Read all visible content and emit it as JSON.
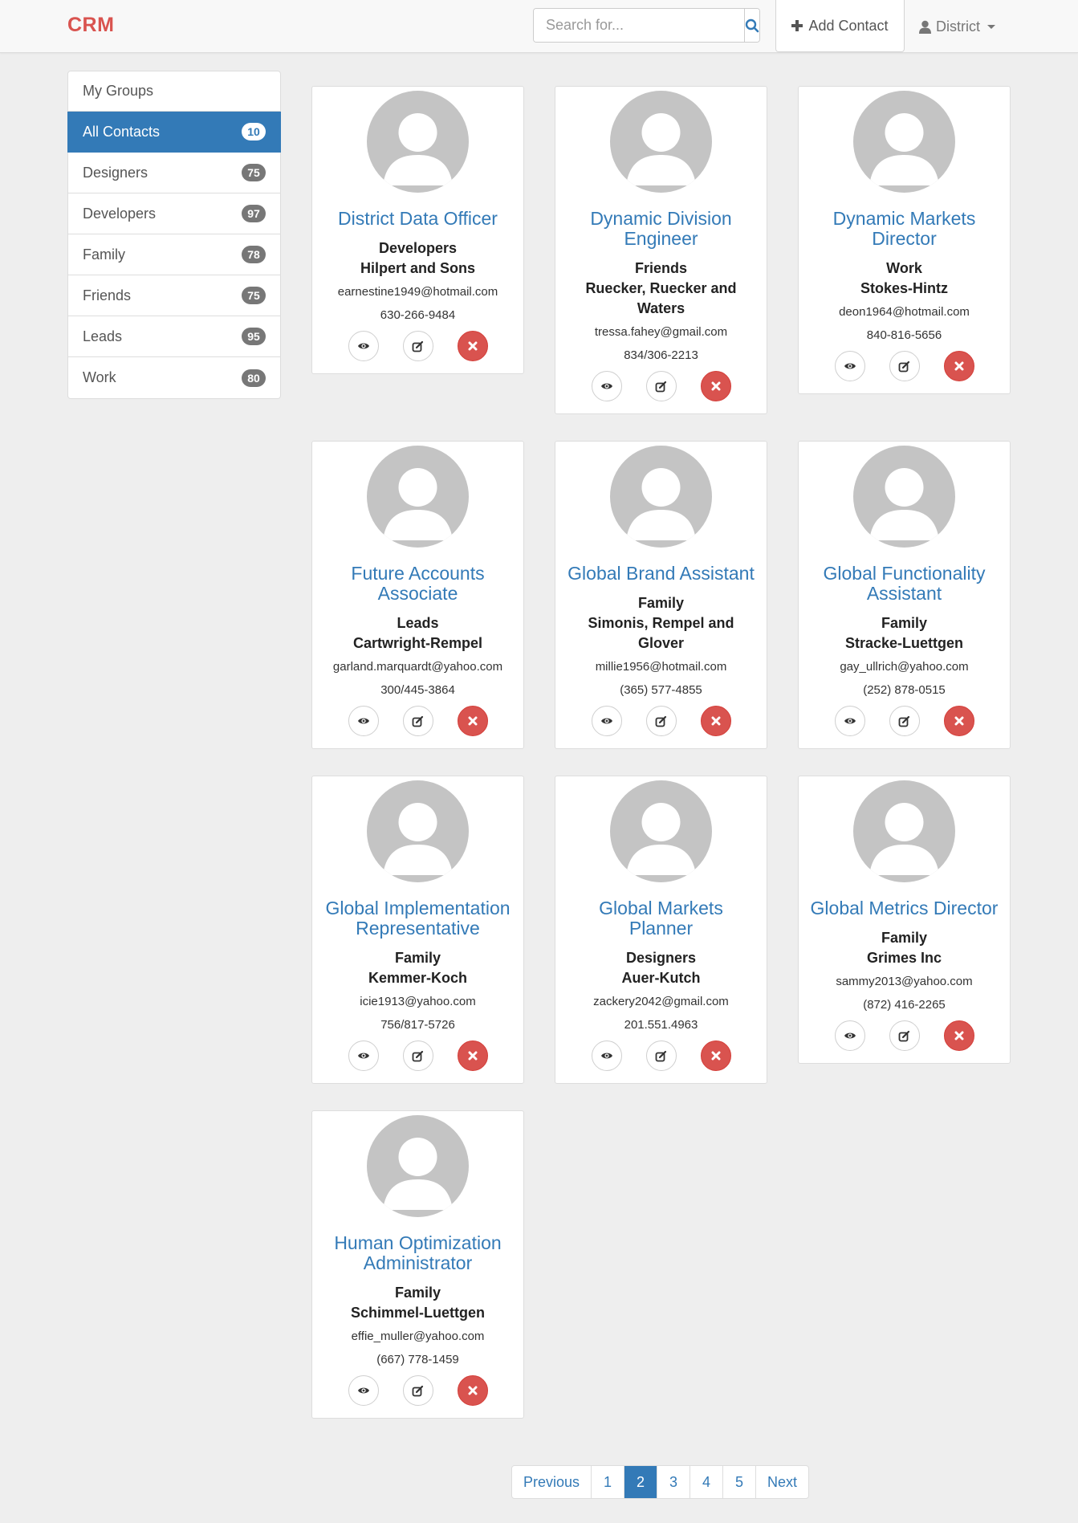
{
  "brand": "CRM",
  "search": {
    "placeholder": "Search for..."
  },
  "toolbar": {
    "add_contact_label": "Add Contact"
  },
  "user": {
    "name": "District"
  },
  "sidebar": {
    "heading": "My Groups",
    "items": [
      {
        "label": "All Contacts",
        "count": "10",
        "active": true
      },
      {
        "label": "Designers",
        "count": "75"
      },
      {
        "label": "Developers",
        "count": "97"
      },
      {
        "label": "Family",
        "count": "78"
      },
      {
        "label": "Friends",
        "count": "75"
      },
      {
        "label": "Leads",
        "count": "95"
      },
      {
        "label": "Work",
        "count": "80"
      }
    ]
  },
  "contacts": [
    {
      "title": "District Data Officer",
      "group": "Developers",
      "company": "Hilpert and Sons",
      "email": "earnestine1949@hotmail.com",
      "phone": "630-266-9484"
    },
    {
      "title": "Dynamic Division Engineer",
      "group": "Friends",
      "company": "Ruecker, Ruecker and Waters",
      "email": "tressa.fahey@gmail.com",
      "phone": "834/306-2213"
    },
    {
      "title": "Dynamic Markets Director",
      "group": "Work",
      "company": "Stokes-Hintz",
      "email": "deon1964@hotmail.com",
      "phone": "840-816-5656"
    },
    {
      "title": "Future Accounts Associate",
      "group": "Leads",
      "company": "Cartwright-Rempel",
      "email": "garland.marquardt@yahoo.com",
      "phone": "300/445-3864"
    },
    {
      "title": "Global Brand Assistant",
      "group": "Family",
      "company": "Simonis, Rempel and Glover",
      "email": "millie1956@hotmail.com",
      "phone": "(365) 577-4855"
    },
    {
      "title": "Global Functionality Assistant",
      "group": "Family",
      "company": "Stracke-Luettgen",
      "email": "gay_ullrich@yahoo.com",
      "phone": "(252) 878-0515"
    },
    {
      "title": "Global Implementation Representative",
      "group": "Family",
      "company": "Kemmer-Koch",
      "email": "icie1913@yahoo.com",
      "phone": "756/817-5726"
    },
    {
      "title": "Global Markets Planner",
      "group": "Designers",
      "company": "Auer-Kutch",
      "email": "zackery2042@gmail.com",
      "phone": "201.551.4963"
    },
    {
      "title": "Global Metrics Director",
      "group": "Family",
      "company": "Grimes Inc",
      "email": "sammy2013@yahoo.com",
      "phone": "(872) 416-2265"
    },
    {
      "title": "Human Optimization Administrator",
      "group": "Family",
      "company": "Schimmel-Luettgen",
      "email": "effie_muller@yahoo.com",
      "phone": "(667) 778-1459"
    }
  ],
  "pagination": {
    "previous": "Previous",
    "pages": [
      "1",
      "2",
      "3",
      "4",
      "5"
    ],
    "active_page": "2",
    "next": "Next"
  },
  "colors": {
    "brand": "#d9534f",
    "primary": "#337ab7",
    "danger": "#d9534f",
    "badge": "#777777",
    "avatar": "#c4c4c4",
    "background": "#eeeeee"
  }
}
